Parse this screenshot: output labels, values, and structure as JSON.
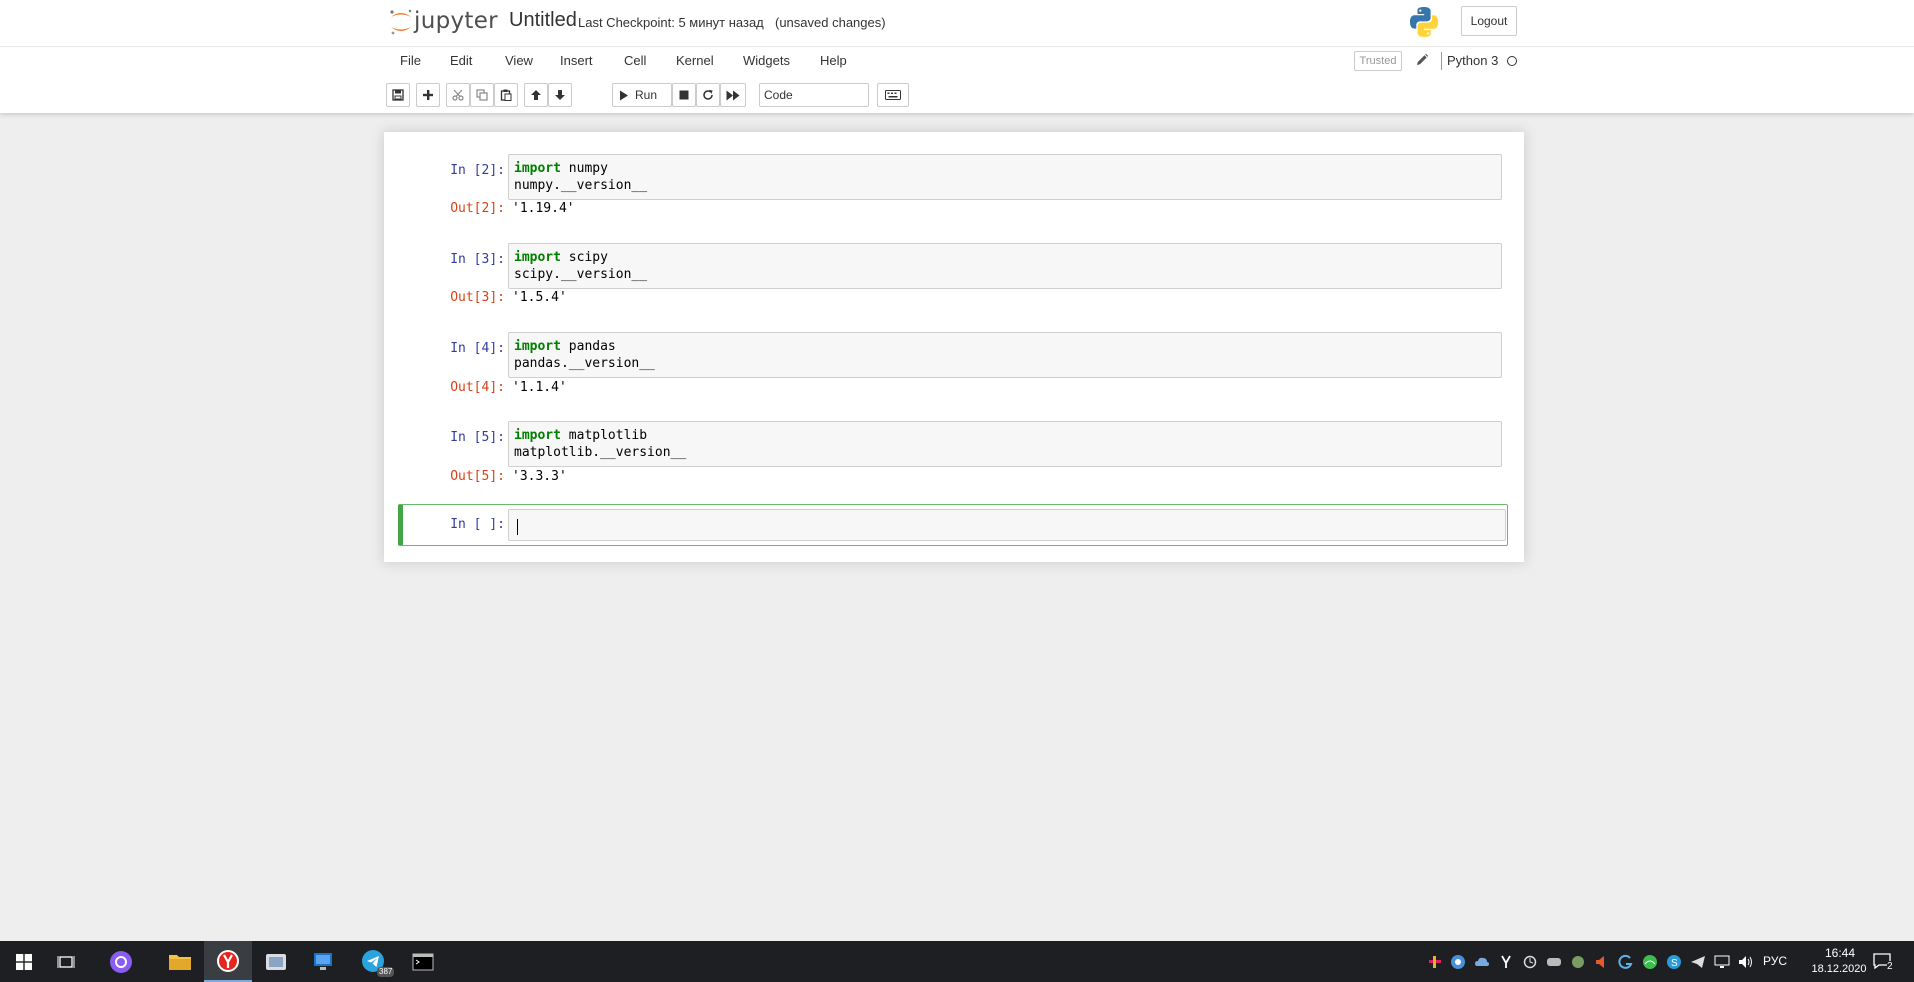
{
  "header": {
    "logo_text": "jupyter",
    "notebook_name": "Untitled",
    "checkpoint": "Last Checkpoint: 5 минут назад",
    "autosave": "(unsaved changes)",
    "logout_label": "Logout"
  },
  "menubar": {
    "items": [
      "File",
      "Edit",
      "View",
      "Insert",
      "Cell",
      "Kernel",
      "Widgets",
      "Help"
    ],
    "trusted_label": "Trusted",
    "kernel_name": "Python 3"
  },
  "toolbar": {
    "run_label": "Run",
    "cell_type": "Code"
  },
  "cells": [
    {
      "in_prompt": "In [2]:",
      "kw": "import",
      "module": " numpy",
      "line2": "numpy.__version__",
      "out_prompt": "Out[2]:",
      "output": "'1.19.4'"
    },
    {
      "in_prompt": "In [3]:",
      "kw": "import",
      "module": " scipy",
      "line2": "scipy.__version__",
      "out_prompt": "Out[3]:",
      "output": "'1.5.4'"
    },
    {
      "in_prompt": "In [4]:",
      "kw": "import",
      "module": " pandas",
      "line2": "pandas.__version__",
      "out_prompt": "Out[4]:",
      "output": "'1.1.4'"
    },
    {
      "in_prompt": "In [5]:",
      "kw": "import",
      "module": " matplotlib",
      "line2": "matplotlib.__version__",
      "out_prompt": "Out[5]:",
      "output": "'3.3.3'"
    }
  ],
  "active_cell": {
    "in_prompt": "In [ ]:"
  },
  "taskbar": {
    "language": "РУС",
    "time": "16:44",
    "date": "18.12.2020",
    "telegram_badge": "387",
    "notification_count": "2"
  },
  "colors": {
    "accent_orange": "#f37726",
    "active_cell_border": "#42a547",
    "in_prompt": "#303f9f",
    "out_prompt": "#d84315",
    "keyword": "#008000"
  }
}
